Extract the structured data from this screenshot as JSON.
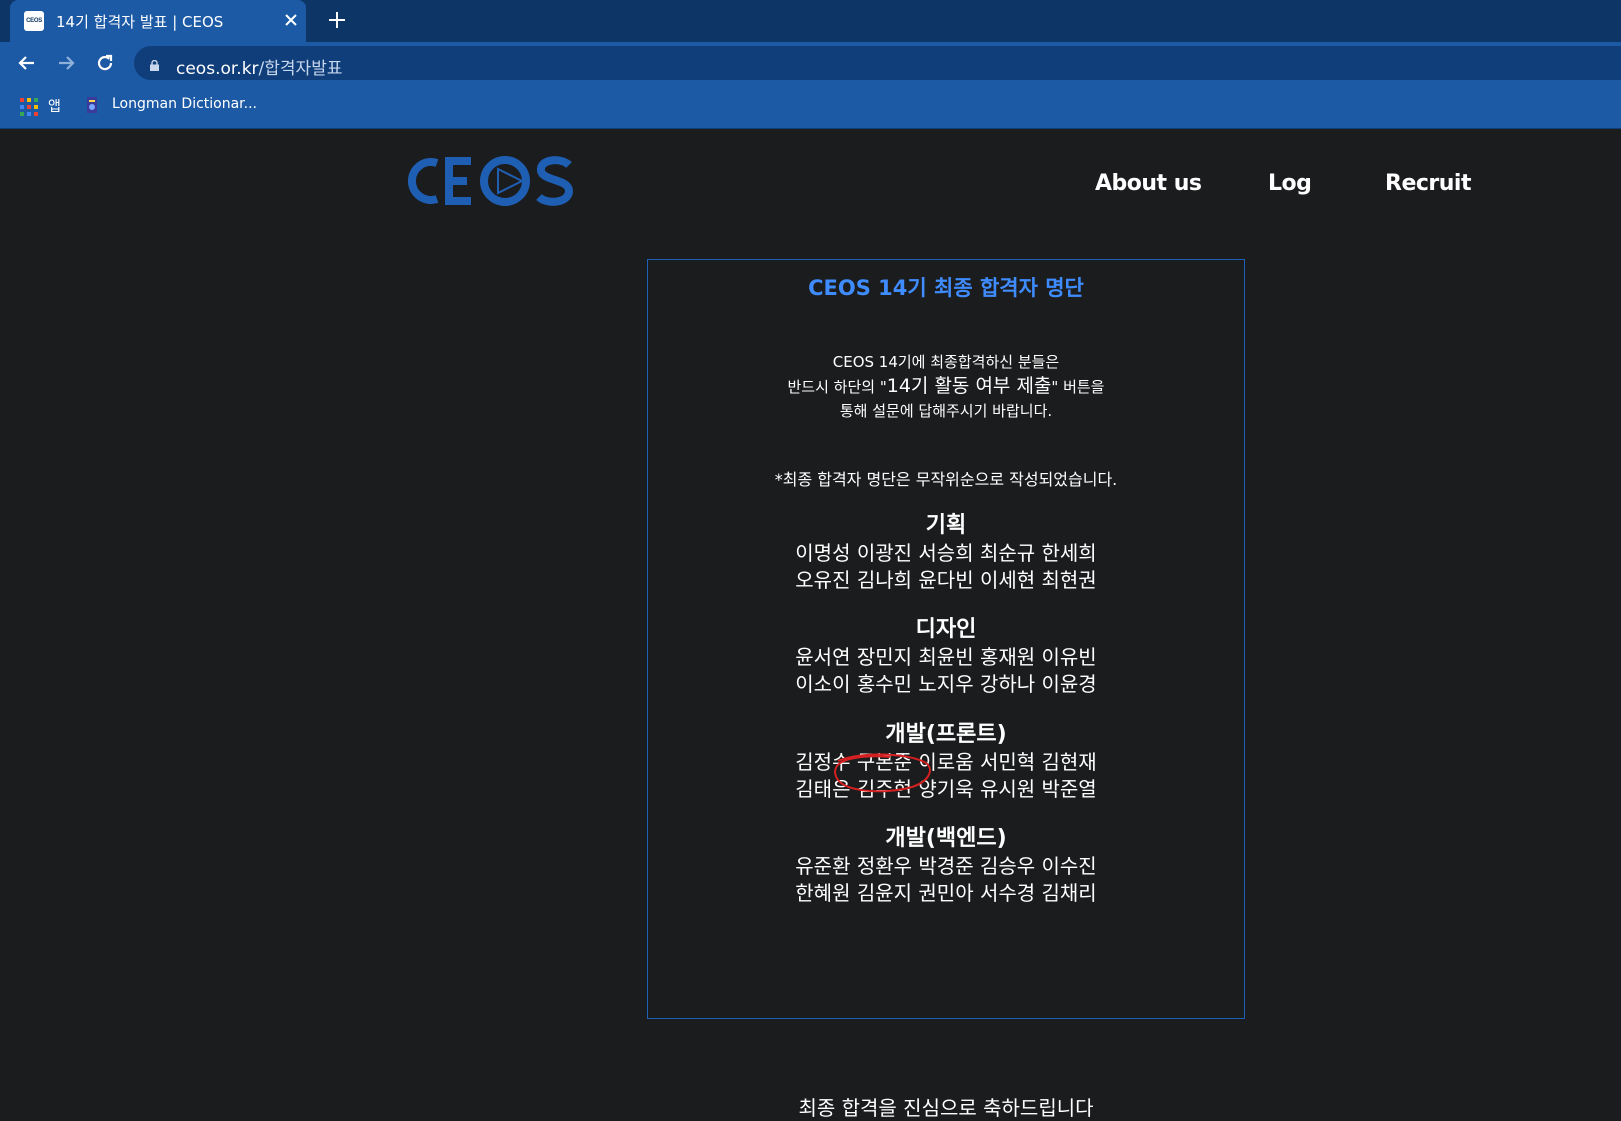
{
  "browser": {
    "tab_title": "14기 합격자 발표 | CEOS",
    "favicon_text": "CEOS",
    "url_host": "ceos.or.kr",
    "url_path": "/합격자발표",
    "bookmarks": [
      {
        "label": "앱"
      },
      {
        "label": "Longman Dictionar..."
      }
    ],
    "icons": {
      "back": "arrow-left-icon",
      "forward": "arrow-right-icon",
      "reload": "reload-icon",
      "lock": "lock-icon",
      "close": "close-icon",
      "new_tab": "plus-icon"
    }
  },
  "site": {
    "logo_text": "CEOS",
    "nav": [
      {
        "label": "About us"
      },
      {
        "label": "Log"
      },
      {
        "label": "Recruit"
      }
    ],
    "colors": {
      "background": "#1b1c1e",
      "accent": "#3f8cff",
      "logo": "#1f5fb3",
      "chrome": "#1c5aa6"
    }
  },
  "announcement": {
    "title": "CEOS 14기 최종 합격자 명단",
    "intro_line1": "CEOS 14기에 최종합격하신 분들은",
    "intro_line2_a": "반드시 하단의 \"",
    "intro_line2_big": "14기 활동 여부 제출",
    "intro_line2_b": "\" 버튼을",
    "intro_line3": "통해 설문에 답해주시기 바랍니다.",
    "note": "*최종 합격자 명단은 무작위순으로 작성되었습니다.",
    "sections": [
      {
        "title": "기획",
        "lines": [
          "이명성 이광진 서승희 최순규 한세희",
          "오유진 김나희 윤다빈 이세현 최현권"
        ]
      },
      {
        "title": "디자인",
        "lines": [
          "윤서연 장민지 최윤빈 홍재원 이유빈",
          "이소이 홍수민 노지우 강하나 이윤경"
        ]
      },
      {
        "title": "개발(프론트)",
        "lines": [
          "김정수 구본준 이로움 서민혁 김현재",
          "김태은 김주현 양기욱 유시원 박준열"
        ]
      },
      {
        "title": "개발(백엔드)",
        "lines": [
          "유준환 정환우 박경준 김승우 이수진",
          "한혜원 김윤지 권민아 서수경 김채리"
        ]
      }
    ],
    "bottom_text": "최종 합격을 진심으로 축하드립니다"
  }
}
